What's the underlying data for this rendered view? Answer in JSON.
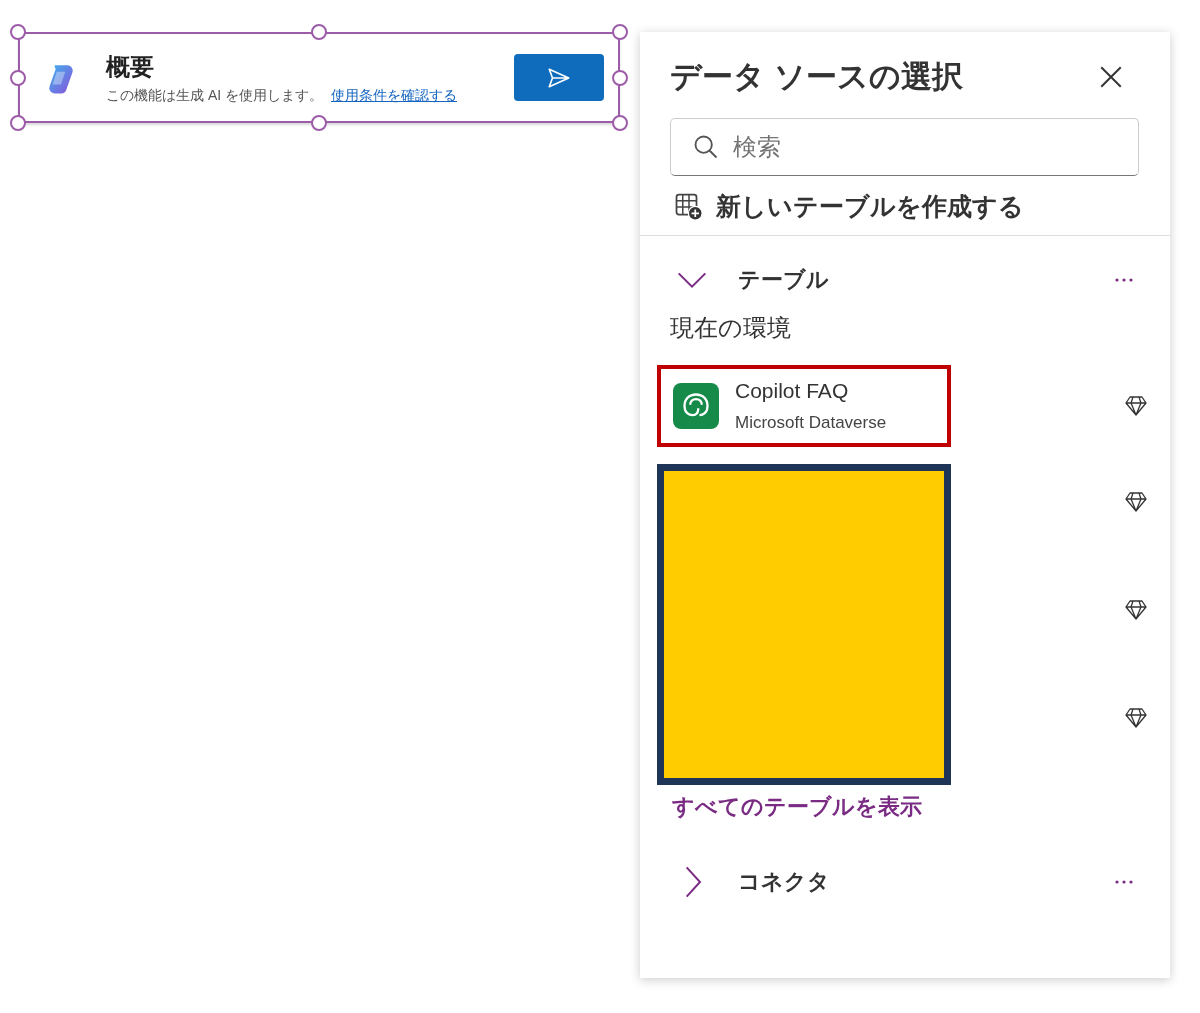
{
  "card": {
    "title": "概要",
    "description": "この機能は生成 AI を使用します。",
    "link": "使用条件を確認する",
    "selected": true
  },
  "panel": {
    "title": "データ ソースの選択",
    "search": {
      "placeholder": "検索"
    },
    "new_table": "新しいテーブルを作成する",
    "sections": [
      {
        "label": "テーブル",
        "expanded": true,
        "group_label": "現在の環境",
        "items": [
          {
            "kind": "visible",
            "name": "Copilot FAQ",
            "source": "Microsoft Dataverse",
            "highlighted": true
          },
          {
            "kind": "covered"
          },
          {
            "kind": "covered"
          },
          {
            "kind": "covered"
          }
        ],
        "show_all": "すべてのテーブルを表示"
      },
      {
        "label": "コネクタ",
        "expanded": false
      }
    ]
  }
}
